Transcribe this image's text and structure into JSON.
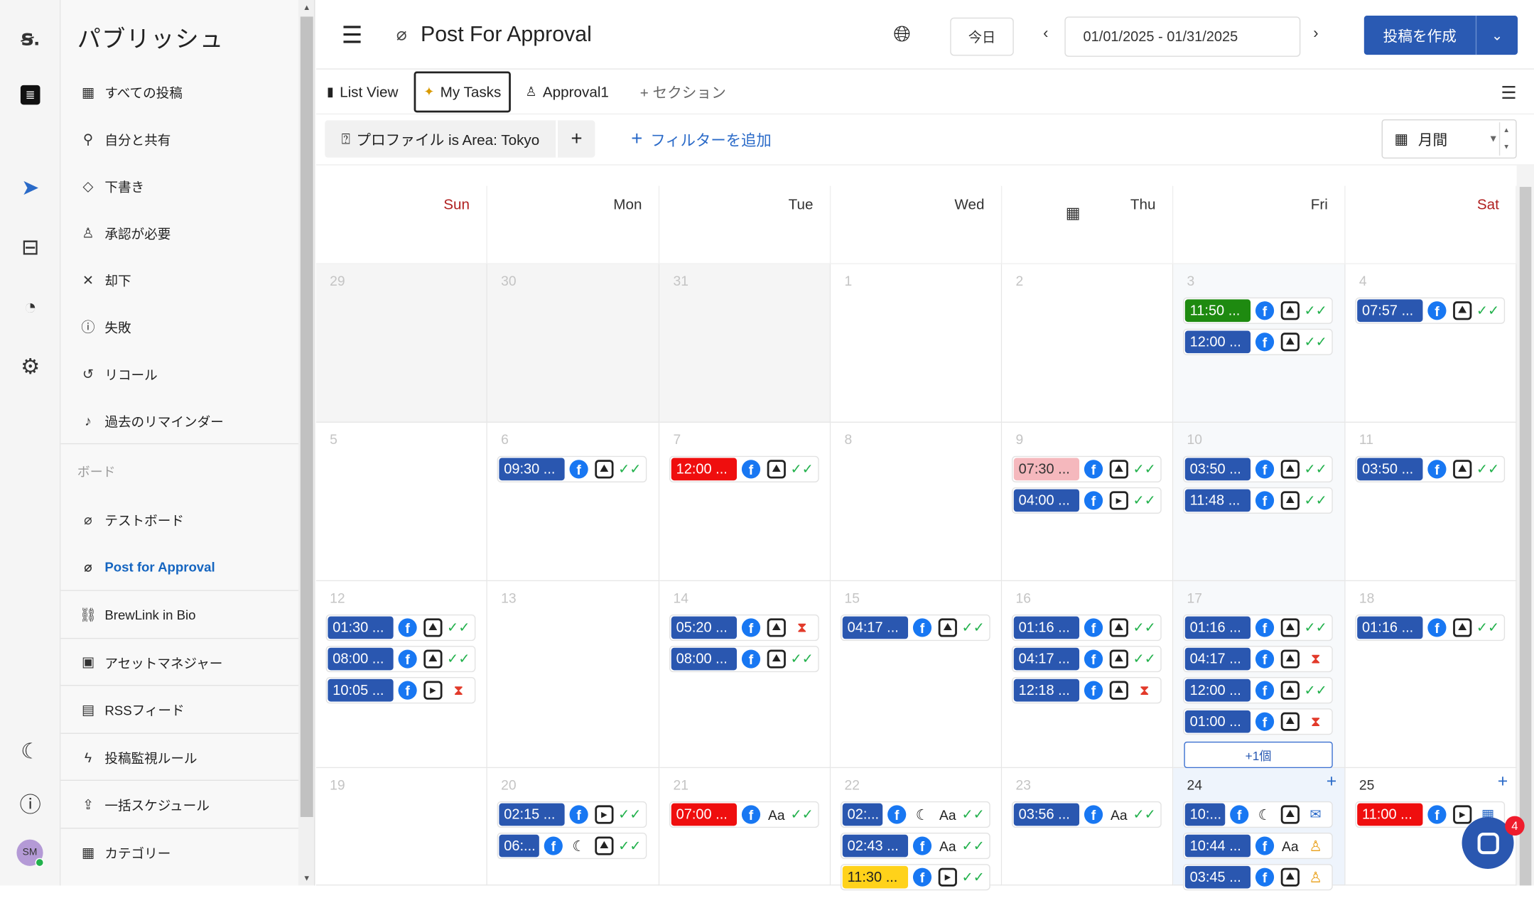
{
  "sidebar": {
    "title": "パブリッシュ",
    "items": [
      {
        "label": "すべての投稿",
        "icon": "calendar-icon"
      },
      {
        "label": "自分と共有",
        "icon": "person-icon"
      },
      {
        "label": "下書き",
        "icon": "draft-icon"
      },
      {
        "label": "承認が必要",
        "icon": "stamp-icon"
      },
      {
        "label": "却下",
        "icon": "close-icon"
      },
      {
        "label": "失敗",
        "icon": "alert-icon"
      },
      {
        "label": "リコール",
        "icon": "recall-icon"
      },
      {
        "label": "過去のリマインダー",
        "icon": "bell-icon"
      }
    ],
    "section_label": "ボード",
    "boards": [
      {
        "label": "テストボード"
      },
      {
        "label": "Post for Approval",
        "active": true
      }
    ],
    "tools": [
      {
        "label": "BrewLink in Bio",
        "icon": "link-icon"
      },
      {
        "label": "アセットマネジャー",
        "icon": "folder-icon"
      },
      {
        "label": "RSSフィード",
        "icon": "rss-icon"
      },
      {
        "label": "投稿監視ルール",
        "icon": "bolt-icon"
      },
      {
        "label": "一括スケジュール",
        "icon": "upload-icon"
      },
      {
        "label": "カテゴリー",
        "icon": "grid-icon"
      }
    ],
    "avatar": "SM"
  },
  "header": {
    "title": "Post For Approval",
    "today": "今日",
    "date_range": "01/01/2025 - 01/31/2025",
    "create": "投稿を作成"
  },
  "tabs": {
    "list_view": "List View",
    "my_tasks": "My Tasks",
    "approval": "Approval1",
    "add_section": "+ セクション"
  },
  "filter": {
    "chip": "プロファイル is Area: Tokyo",
    "add": "フィルターを追加",
    "view": "月間"
  },
  "calendar": {
    "days": [
      "Sun",
      "Mon",
      "Tue",
      "Wed",
      "Thu",
      "Fri",
      "Sat"
    ],
    "weeks": [
      [
        {
          "d": "29",
          "cur": false,
          "ev": []
        },
        {
          "d": "30",
          "cur": false,
          "ev": []
        },
        {
          "d": "31",
          "cur": false,
          "ev": []
        },
        {
          "d": "1",
          "cur": true,
          "ev": []
        },
        {
          "d": "2",
          "cur": true,
          "ev": []
        },
        {
          "d": "3",
          "cur": true,
          "ev": [
            {
              "t": "11:50 ...",
              "c": "green",
              "i": [
                "fb",
                "img",
                "chk"
              ]
            },
            {
              "t": "12:00 ...",
              "c": "blue",
              "i": [
                "fb",
                "img",
                "chk"
              ]
            }
          ]
        },
        {
          "d": "4",
          "cur": true,
          "ev": [
            {
              "t": "07:57 ...",
              "c": "blue",
              "i": [
                "fb",
                "img",
                "chk"
              ]
            }
          ]
        }
      ],
      [
        {
          "d": "5",
          "cur": true,
          "ev": []
        },
        {
          "d": "6",
          "cur": true,
          "ev": [
            {
              "t": "09:30 ...",
              "c": "blue",
              "i": [
                "fb",
                "img",
                "chk"
              ]
            }
          ]
        },
        {
          "d": "7",
          "cur": true,
          "ev": [
            {
              "t": "12:00 ...",
              "c": "red",
              "i": [
                "fb",
                "img",
                "chk"
              ]
            }
          ]
        },
        {
          "d": "8",
          "cur": true,
          "ev": []
        },
        {
          "d": "9",
          "cur": true,
          "ev": [
            {
              "t": "07:30 ...",
              "c": "pink",
              "i": [
                "fb",
                "img",
                "chk"
              ]
            },
            {
              "t": "04:00 ...",
              "c": "blue",
              "i": [
                "fb",
                "vid",
                "chk"
              ]
            }
          ]
        },
        {
          "d": "10",
          "cur": true,
          "ev": [
            {
              "t": "03:50 ...",
              "c": "blue",
              "i": [
                "fb",
                "img",
                "chk"
              ]
            },
            {
              "t": "11:48 ...",
              "c": "blue",
              "i": [
                "fb",
                "img",
                "chk"
              ]
            }
          ]
        },
        {
          "d": "11",
          "cur": true,
          "ev": [
            {
              "t": "03:50 ...",
              "c": "blue",
              "i": [
                "fb",
                "img",
                "chk"
              ]
            }
          ]
        }
      ],
      [
        {
          "d": "12",
          "cur": true,
          "ev": [
            {
              "t": "01:30 ...",
              "c": "blue",
              "i": [
                "fb",
                "img",
                "chk"
              ]
            },
            {
              "t": "08:00 ...",
              "c": "blue",
              "i": [
                "fb",
                "img",
                "chk"
              ]
            },
            {
              "t": "10:05 ...",
              "c": "blue",
              "i": [
                "fb",
                "vid",
                "hour"
              ]
            }
          ]
        },
        {
          "d": "13",
          "cur": true,
          "ev": []
        },
        {
          "d": "14",
          "cur": true,
          "ev": [
            {
              "t": "05:20 ...",
              "c": "blue",
              "i": [
                "fb",
                "img",
                "hour"
              ]
            },
            {
              "t": "08:00 ...",
              "c": "blue",
              "i": [
                "fb",
                "img",
                "chk"
              ]
            }
          ]
        },
        {
          "d": "15",
          "cur": true,
          "ev": [
            {
              "t": "04:17 ...",
              "c": "blue",
              "i": [
                "fb",
                "img",
                "chk"
              ]
            }
          ]
        },
        {
          "d": "16",
          "cur": true,
          "ev": [
            {
              "t": "01:16 ...",
              "c": "blue",
              "i": [
                "fb",
                "img",
                "chk"
              ]
            },
            {
              "t": "04:17 ...",
              "c": "blue",
              "i": [
                "fb",
                "img",
                "chk"
              ]
            },
            {
              "t": "12:18 ...",
              "c": "blue",
              "i": [
                "fb",
                "img",
                "hour"
              ]
            }
          ]
        },
        {
          "d": "17",
          "cur": true,
          "ev": [
            {
              "t": "01:16 ...",
              "c": "blue",
              "i": [
                "fb",
                "img",
                "chk"
              ]
            },
            {
              "t": "04:17 ...",
              "c": "blue",
              "i": [
                "fb",
                "img",
                "hour"
              ]
            },
            {
              "t": "12:00 ...",
              "c": "blue",
              "i": [
                "fb",
                "img",
                "chk"
              ]
            },
            {
              "t": "01:00 ...",
              "c": "blue",
              "i": [
                "fb",
                "img",
                "hour"
              ]
            }
          ],
          "more": "+1個"
        },
        {
          "d": "18",
          "cur": true,
          "ev": [
            {
              "t": "01:16 ...",
              "c": "blue",
              "i": [
                "fb",
                "img",
                "chk"
              ]
            }
          ]
        }
      ],
      [
        {
          "d": "19",
          "cur": true,
          "ev": []
        },
        {
          "d": "20",
          "cur": true,
          "ev": [
            {
              "t": "02:15 ...",
              "c": "blue",
              "i": [
                "fb",
                "vid",
                "chk"
              ]
            },
            {
              "t": "06:...",
              "c": "blue",
              "i": [
                "fb",
                "moon",
                "img",
                "chk"
              ]
            }
          ]
        },
        {
          "d": "21",
          "cur": true,
          "ev": [
            {
              "t": "07:00 ...",
              "c": "red",
              "i": [
                "fb",
                "aa",
                "chk"
              ]
            }
          ]
        },
        {
          "d": "22",
          "cur": true,
          "ev": [
            {
              "t": "02:...",
              "c": "blue",
              "i": [
                "fb",
                "moon",
                "aa",
                "chk"
              ]
            },
            {
              "t": "02:43 ...",
              "c": "blue",
              "i": [
                "fb",
                "aa",
                "chk"
              ]
            },
            {
              "t": "11:30 ...",
              "c": "yellow",
              "i": [
                "fb",
                "vid",
                "chk"
              ]
            }
          ]
        },
        {
          "d": "23",
          "cur": true,
          "ev": [
            {
              "t": "03:56 ...",
              "c": "blue",
              "i": [
                "fb",
                "aa",
                "chk"
              ]
            }
          ]
        },
        {
          "d": "24",
          "cur": true,
          "today": true,
          "ev": [
            {
              "t": "10:...",
              "c": "blue",
              "i": [
                "fb",
                "moon",
                "img",
                "envl"
              ]
            },
            {
              "t": "10:44 ...",
              "c": "blue",
              "i": [
                "fb",
                "aa",
                "stamp"
              ]
            },
            {
              "t": "03:45 ...",
              "c": "blue",
              "i": [
                "fb",
                "img",
                "stamp"
              ]
            }
          ]
        },
        {
          "d": "25",
          "cur": true,
          "ev": [
            {
              "t": "11:00 ...",
              "c": "red",
              "i": [
                "fb",
                "vid",
                "cald"
              ]
            }
          ]
        }
      ]
    ]
  },
  "chat_badge": "4",
  "colors": {
    "primary": "#2a5ab3",
    "event_blue": "#2a57b0",
    "event_green": "#1e8a10",
    "event_red": "#ef0e0e",
    "event_pink": "#f5b8bd",
    "event_yellow": "#ffd21a",
    "approved": "#22b14c",
    "sunday": "#b02020"
  }
}
